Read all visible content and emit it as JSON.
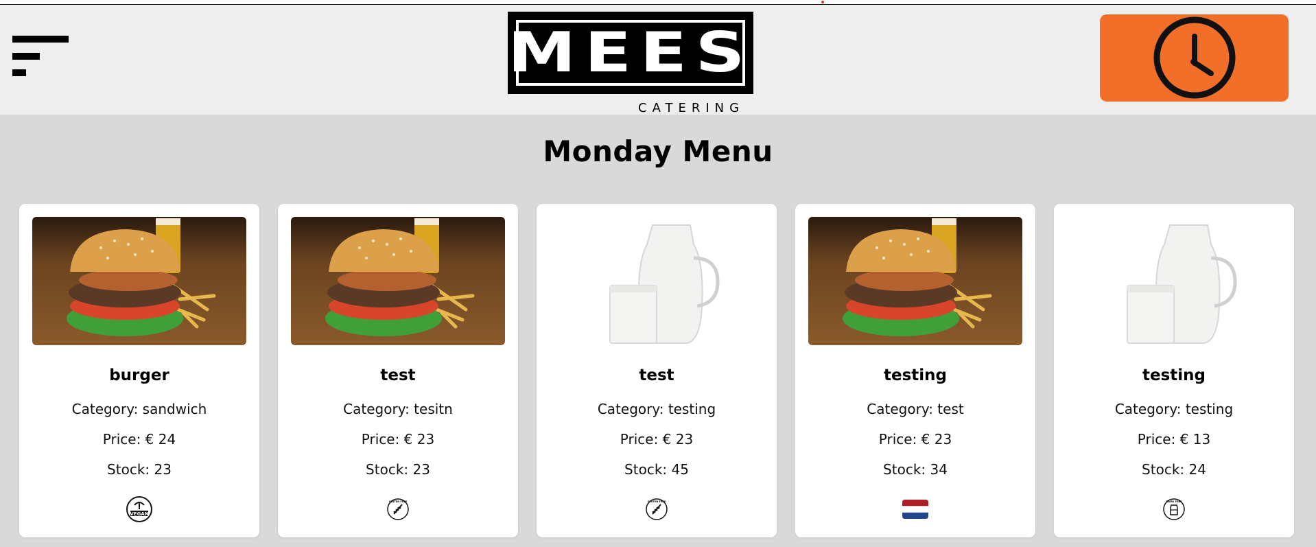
{
  "header": {
    "logo_word": "MEES",
    "logo_sub": "CATERING",
    "menu_icon": "menu-icon",
    "clock_icon": "clock-icon",
    "accent_color": "#f26f2a"
  },
  "page_title": "Monday Menu",
  "products": [
    {
      "name": "burger",
      "category": "Category: sandwich",
      "price": "Price: € 24",
      "stock": "Stock: 23",
      "image": "burger",
      "badge": "vegan-icon",
      "badge_text": "VEGAN"
    },
    {
      "name": "test",
      "category": "Category: tesitn",
      "price": "Price: € 23",
      "stock": "Stock: 23",
      "image": "burger",
      "badge": "gluten-free-icon",
      "badge_text": "GLUTEN FREE"
    },
    {
      "name": "test",
      "category": "Category: testing",
      "price": "Price: € 23",
      "stock": "Stock: 45",
      "image": "milk",
      "badge": "gluten-free-icon",
      "badge_text": "GLUTEN FREE"
    },
    {
      "name": "testing",
      "category": "Category: test",
      "price": "Price: € 23",
      "stock": "Stock: 34",
      "image": "burger",
      "badge": "dutch-flag-icon"
    },
    {
      "name": "testing",
      "category": "Category: testing",
      "price": "Price: € 13",
      "stock": "Stock: 24",
      "image": "milk",
      "badge": "dairy-free-icon",
      "badge_text": "DAIRY FREE"
    }
  ]
}
